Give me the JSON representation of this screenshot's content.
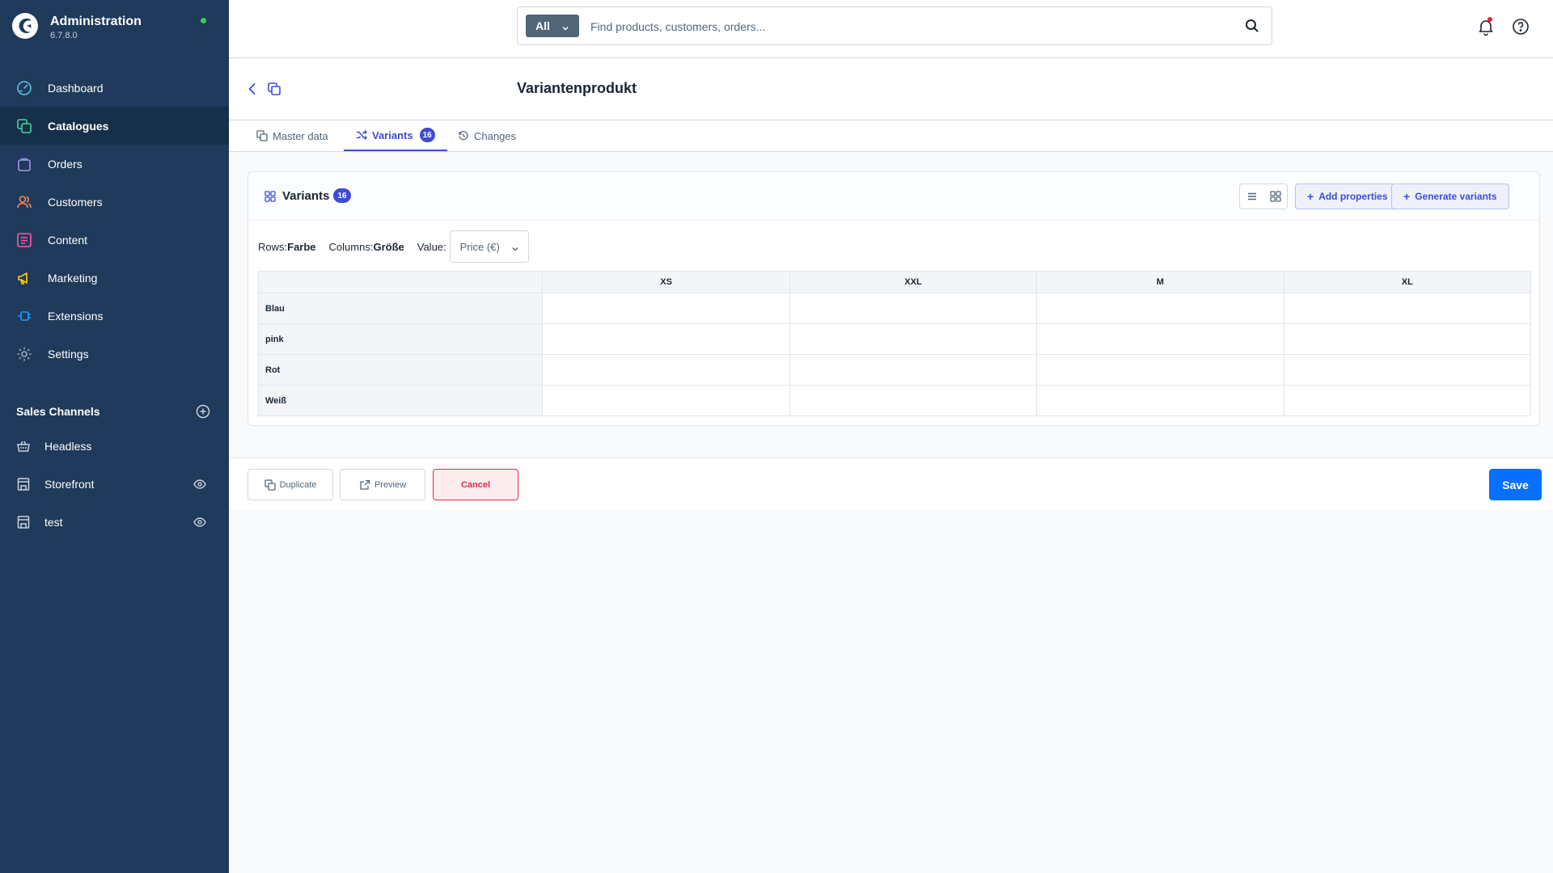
{
  "brand": {
    "title": "Administration",
    "version": "6.7.8.0",
    "status_color": "#37d046"
  },
  "sidebar": {
    "items": [
      {
        "label": "Dashboard",
        "icon": "dashboard-gauge-icon",
        "color": "#58c6e8"
      },
      {
        "label": "Catalogues",
        "icon": "catalogue-icon",
        "color": "#4ad59a",
        "active": true
      },
      {
        "label": "Orders",
        "icon": "orders-bag-icon",
        "color": "#a195f2"
      },
      {
        "label": "Customers",
        "icon": "customers-icon",
        "color": "#f9875f"
      },
      {
        "label": "Content",
        "icon": "content-icon",
        "color": "#ff57a6"
      },
      {
        "label": "Marketing",
        "icon": "marketing-megaphone-icon",
        "color": "#ffd000"
      },
      {
        "label": "Extensions",
        "icon": "extensions-plug-icon",
        "color": "#189eff"
      },
      {
        "label": "Settings",
        "icon": "settings-gear-icon",
        "color": "#a0aebd"
      }
    ],
    "sales_channels_title": "Sales Channels",
    "sales_channels": [
      {
        "label": "Headless",
        "icon": "basket-icon",
        "has_preview": false
      },
      {
        "label": "Storefront",
        "icon": "storefront-icon",
        "has_preview": true
      },
      {
        "label": "test",
        "icon": "storefront-icon",
        "has_preview": true
      }
    ]
  },
  "search": {
    "type_label": "All",
    "placeholder": "Find products, customers, orders..."
  },
  "page": {
    "title": "Variantenprodukt"
  },
  "tabs": [
    {
      "label": "Master data",
      "icon": "copy-icon"
    },
    {
      "label": "Variants",
      "icon": "shuffle-icon",
      "badge": "16",
      "active": true
    },
    {
      "label": "Changes",
      "icon": "history-icon"
    }
  ],
  "card": {
    "title": "Variants",
    "badge": "16",
    "add_properties_label": "Add properties",
    "generate_variants_label": "Generate variants"
  },
  "filters": {
    "rows_label": "Rows:",
    "rows_value": "Farbe",
    "columns_label": "Columns:",
    "columns_value": "Größe",
    "value_label": "Value:",
    "value_selected": "Price (€)"
  },
  "matrix": {
    "columns": [
      "XS",
      "XXL",
      "M",
      "XL"
    ],
    "rows": [
      "Blau",
      "pink",
      "Rot",
      "Weiß"
    ]
  },
  "actions": {
    "duplicate_label": "Duplicate",
    "preview_label": "Preview",
    "cancel_label": "Cancel",
    "save_label": "Save"
  },
  "colors": {
    "sidebar_bg": "#1f3a5a",
    "accent": "#3e4bd8",
    "primary_button": "#0870ff",
    "danger": "#de294c"
  }
}
